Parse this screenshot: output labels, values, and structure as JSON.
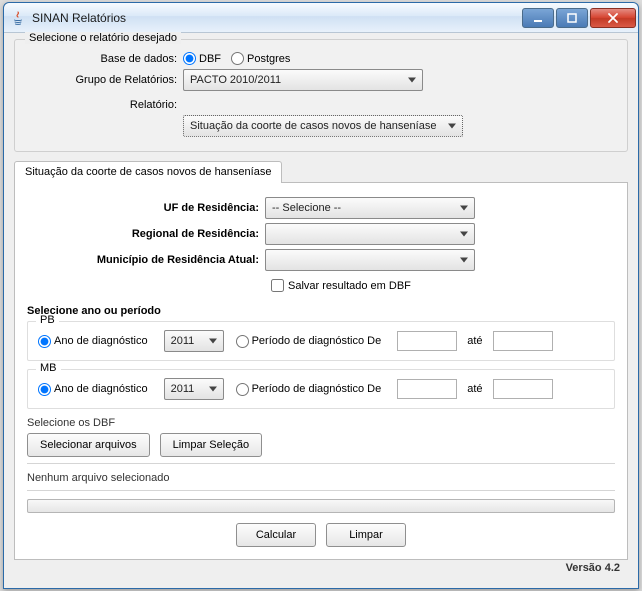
{
  "window": {
    "title": "SINAN Relatórios"
  },
  "top_group": {
    "title": "Selecione o relatório desejado",
    "db_label": "Base de dados:",
    "db_dbf": "DBF",
    "db_postgres": "Postgres",
    "grupo_label": "Grupo de Relatórios:",
    "grupo_value": "PACTO 2010/2011",
    "relatorio_label": "Relatório:",
    "relatorio_value": "Situação da coorte de casos novos de hanseníase"
  },
  "tab": {
    "label": "Situação da coorte de casos novos de hanseníase",
    "uf_label": "UF de Residência:",
    "uf_value": "-- Selecione --",
    "regional_label": "Regional de Residência:",
    "regional_value": "",
    "municipio_label": "Município de Residência Atual:",
    "municipio_value": "",
    "salvar_dbf": "Salvar resultado em DBF",
    "period_heading": "Selecione ano ou período",
    "pb": {
      "title": "PB",
      "ano_label": "Ano de diagnóstico",
      "ano_value": "2011",
      "periodo_label": "Período de diagnóstico De",
      "ate_label": "até"
    },
    "mb": {
      "title": "MB",
      "ano_label": "Ano de diagnóstico",
      "ano_value": "2011",
      "periodo_label": "Período de diagnóstico De",
      "ate_label": "até"
    },
    "dbf_heading": "Selecione os DBF",
    "btn_selecionar": "Selecionar arquivos",
    "btn_limpar_sel": "Limpar Seleção",
    "no_file": "Nenhum arquivo selecionado",
    "btn_calcular": "Calcular",
    "btn_limpar": "Limpar"
  },
  "footer": {
    "version": "Versão 4.2"
  }
}
